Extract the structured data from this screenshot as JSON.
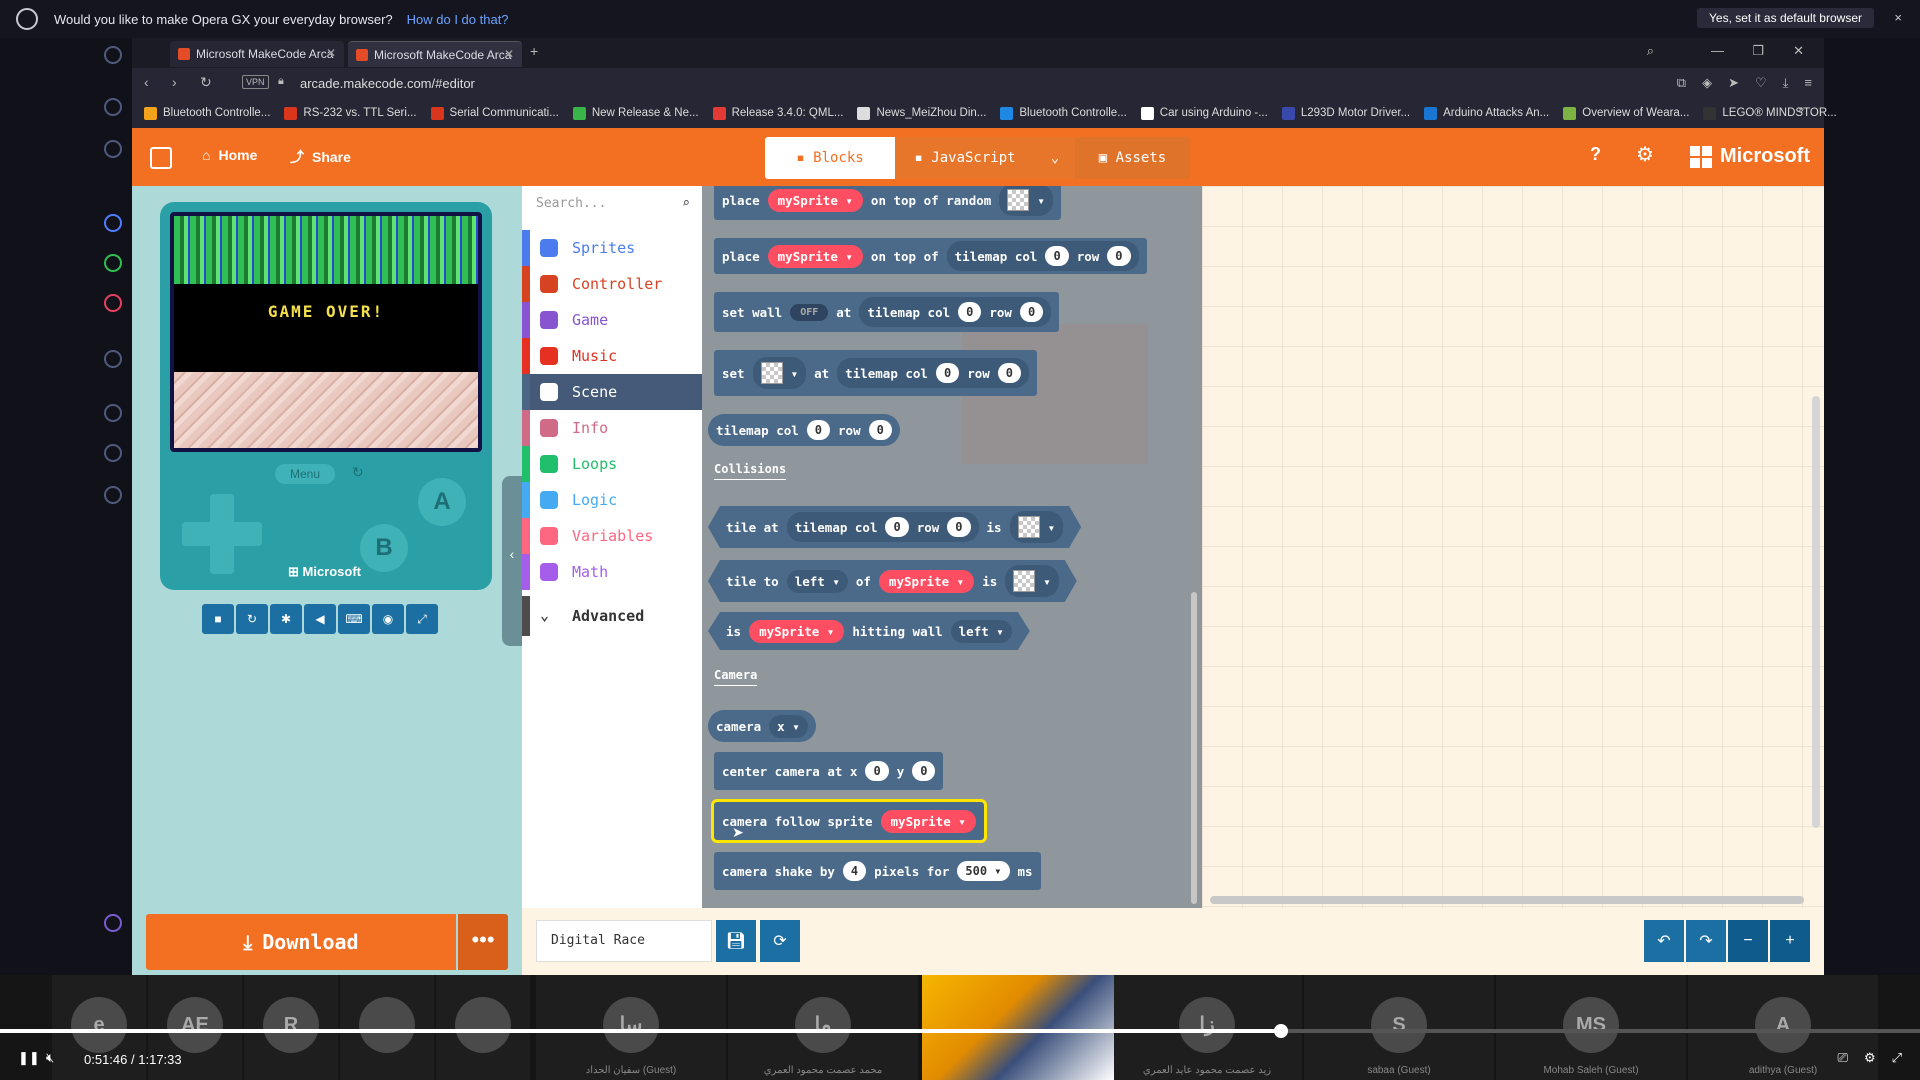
{
  "banner": {
    "question": "Would you like to make Opera GX your everyday browser?",
    "link": "How do I do that?",
    "set_default": "Yes, set it as default browser",
    "close": "×"
  },
  "tabs": [
    {
      "title": "Microsoft MakeCode Arca"
    },
    {
      "title": "Microsoft MakeCode Arca"
    }
  ],
  "address": {
    "vpn": "VPN",
    "url": "arcade.makecode.com/#editor"
  },
  "bookmarks": [
    {
      "label": "Bluetooth Controlle...",
      "color": "#f3a21b"
    },
    {
      "label": "RS-232 vs. TTL Seri...",
      "color": "#d9361c"
    },
    {
      "label": "Serial Communicati...",
      "color": "#d9361c"
    },
    {
      "label": "New Release & Ne...",
      "color": "#3ab54a"
    },
    {
      "label": "Release 3.4.0: QML...",
      "color": "#e53935"
    },
    {
      "label": "News_MeiZhou Din...",
      "color": "#dddddd"
    },
    {
      "label": "Bluetooth Controlle...",
      "color": "#1e88e5"
    },
    {
      "label": "Car using Arduino -...",
      "color": "#ffffff"
    },
    {
      "label": "L293D Motor Driver...",
      "color": "#3949ab"
    },
    {
      "label": "Arduino Attacks An...",
      "color": "#1976d2"
    },
    {
      "label": "Overview of Weara...",
      "color": "#7cb342"
    },
    {
      "label": "LEGO® MINDSTOR...",
      "color": "#333333"
    }
  ],
  "header": {
    "home": "Home",
    "share": "Share",
    "blocks": "Blocks",
    "javascript": "JavaScript",
    "assets": "Assets",
    "brand": "Microsoft"
  },
  "simulator": {
    "game_over": "GAME OVER!",
    "menu": "Menu",
    "a": "A",
    "b": "B",
    "brand": "Microsoft",
    "download": "Download",
    "more": "•••"
  },
  "toolbox": {
    "search_placeholder": "Search...",
    "categories": [
      {
        "label": "Sprites",
        "color": "#4b7bec"
      },
      {
        "label": "Controller",
        "color": "#d54322"
      },
      {
        "label": "Game",
        "color": "#8854d0"
      },
      {
        "label": "Music",
        "color": "#e63022"
      },
      {
        "label": "Scene",
        "color": "#4b6584"
      },
      {
        "label": "Info",
        "color": "#cf6a87"
      },
      {
        "label": "Loops",
        "color": "#20bf6b"
      },
      {
        "label": "Logic",
        "color": "#45aaf2"
      },
      {
        "label": "Variables",
        "color": "#ff6680"
      },
      {
        "label": "Math",
        "color": "#a55eea"
      }
    ],
    "advanced": "Advanced"
  },
  "flyout": {
    "place": "place",
    "on_top_of_random": "on top of random",
    "on_top_of": "on top of",
    "tilemap_col": "tilemap col",
    "row": "row",
    "zero": "0",
    "set_wall": "set wall",
    "off": "OFF",
    "at": "at",
    "set": "set",
    "sprite": "mySprite",
    "collisions": "Collisions",
    "tile_at": "tile at",
    "is": "is",
    "tile_to": "tile to",
    "left": "left",
    "of": "of",
    "is_word": "is",
    "hitting_wall": "hitting wall",
    "camera_section": "Camera",
    "camera": "camera",
    "x": "x",
    "center_camera": "center camera at x",
    "y": "y",
    "camera_follow": "camera follow sprite",
    "camera_shake": "camera shake by",
    "four": "4",
    "pixels_for": "pixels for",
    "five_hundred": "500",
    "ms": "ms"
  },
  "bottom": {
    "project_name": "Digital Race"
  },
  "meeting": {
    "participants": [
      {
        "initials": "e",
        "name": ""
      },
      {
        "initials": "AE",
        "name": ""
      },
      {
        "initials": "R",
        "name": ""
      },
      {
        "initials": "",
        "name": ""
      },
      {
        "initials": "",
        "name": ""
      },
      {
        "initials": "سا",
        "name": "سفيان الحداد (Guest)"
      },
      {
        "initials": "ما",
        "name": "محمد عصمت محمود العمري"
      },
      {
        "initials": "زا",
        "name": "زيد عصمت محمود عايد العمري"
      },
      {
        "initials": "S",
        "name": "sabaa (Guest)"
      },
      {
        "initials": "MS",
        "name": "Mohab Saleh (Guest)"
      },
      {
        "initials": "A",
        "name": "adithya (Guest)"
      }
    ],
    "current_time": "0:51:46",
    "separator": "/",
    "duration": "1:17:33",
    "progress": 0.667
  }
}
